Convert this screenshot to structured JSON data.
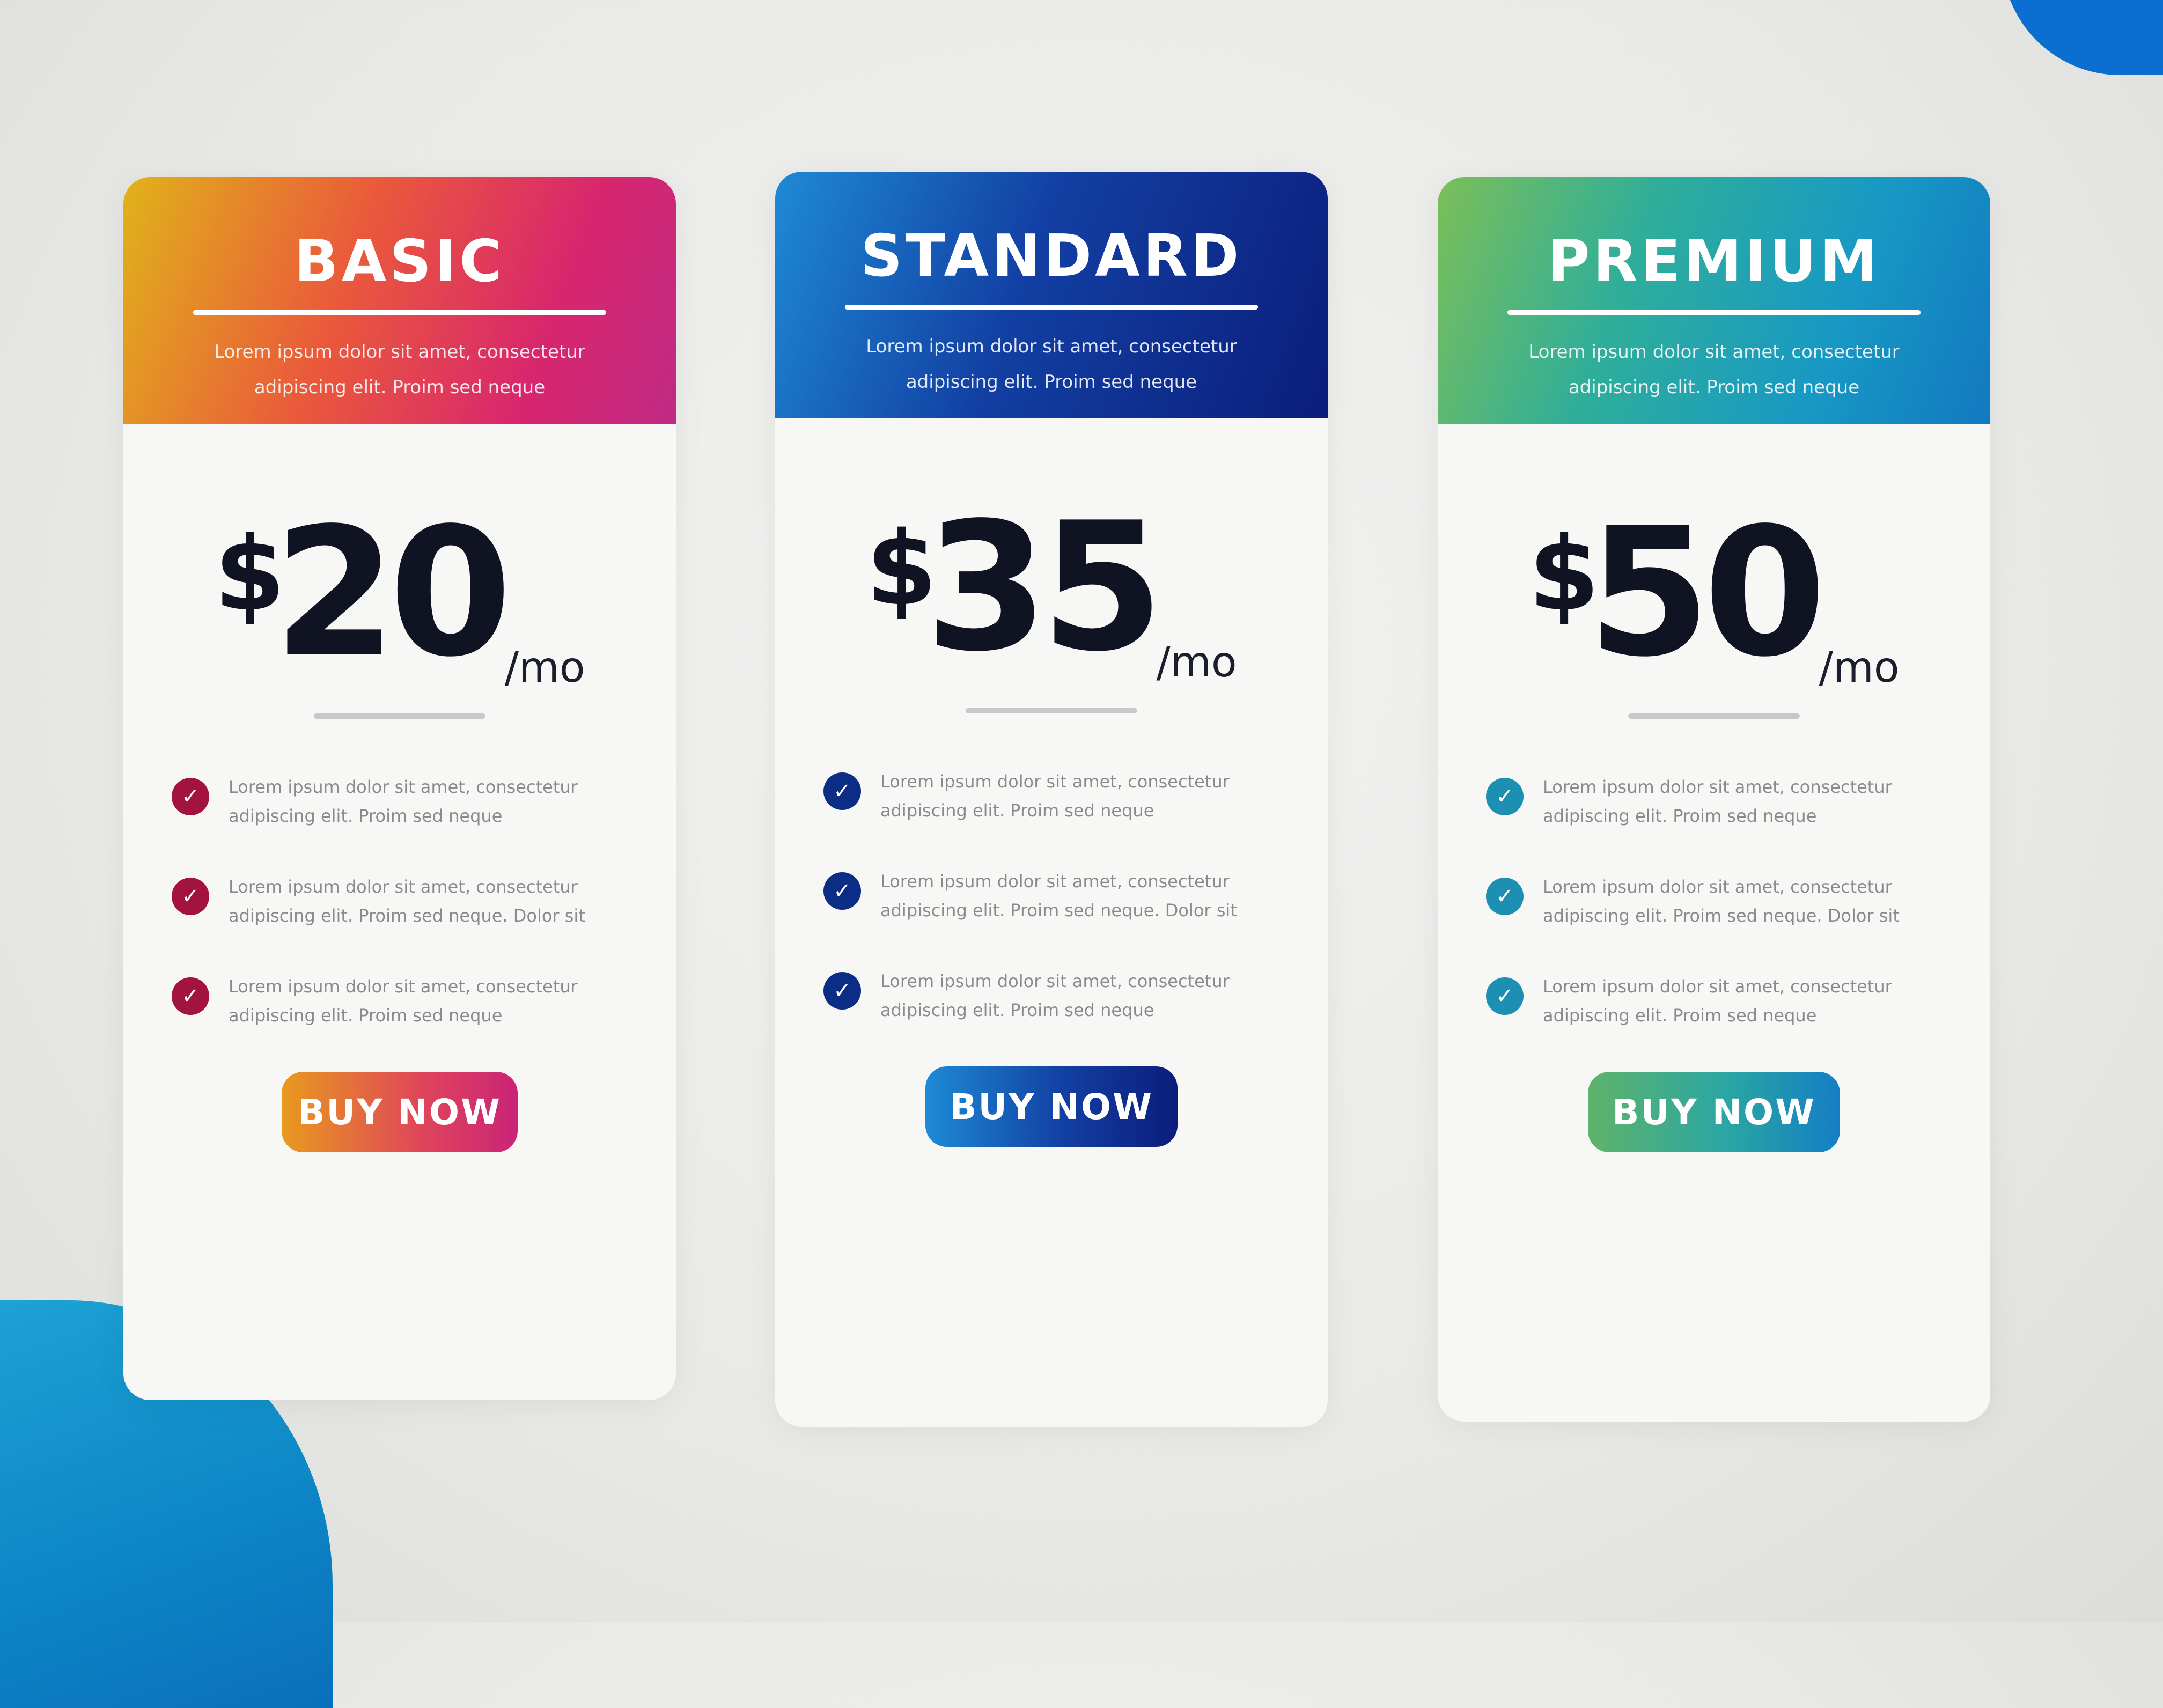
{
  "colors": {
    "basic_accent": "#d8266e",
    "standard_accent": "#0b1d7a",
    "premium_accent": "#1899c4",
    "background": "#ececea"
  },
  "plans": [
    {
      "name": "BASIC",
      "description": "Lorem ipsum dolor sit amet, consectetur adipiscing elit. Proim sed neque",
      "currency": "$",
      "price": "20",
      "period": "/mo",
      "features": [
        "Lorem ipsum dolor sit amet, consectetur adipiscing elit. Proim sed neque",
        "Lorem ipsum dolor sit amet, consectetur adipiscing elit. Proim sed neque. Dolor sit",
        "Lorem ipsum dolor sit amet, consectetur adipiscing elit. Proim sed neque"
      ],
      "check_icon": "check-circle-icon",
      "button_label": "BUY NOW"
    },
    {
      "name": "STANDARD",
      "description": "Lorem ipsum dolor sit amet, consectetur adipiscing elit. Proim sed neque",
      "currency": "$",
      "price": "35",
      "period": "/mo",
      "features": [
        "Lorem ipsum dolor sit amet, consectetur adipiscing elit. Proim sed neque",
        "Lorem ipsum dolor sit amet, consectetur adipiscing elit. Proim sed neque. Dolor sit",
        "Lorem ipsum dolor sit amet, consectetur adipiscing elit. Proim sed neque"
      ],
      "check_icon": "check-circle-icon",
      "button_label": "BUY NOW"
    },
    {
      "name": "PREMIUM",
      "description": "Lorem ipsum dolor sit amet, consectetur adipiscing elit. Proim sed neque",
      "currency": "$",
      "price": "50",
      "period": "/mo",
      "features": [
        "Lorem ipsum dolor sit amet, consectetur adipiscing elit. Proim sed neque",
        "Lorem ipsum dolor sit amet, consectetur adipiscing elit. Proim sed neque. Dolor sit",
        "Lorem ipsum dolor sit amet, consectetur adipiscing elit. Proim sed neque"
      ],
      "check_icon": "check-circle-icon",
      "button_label": "BUY NOW"
    }
  ]
}
